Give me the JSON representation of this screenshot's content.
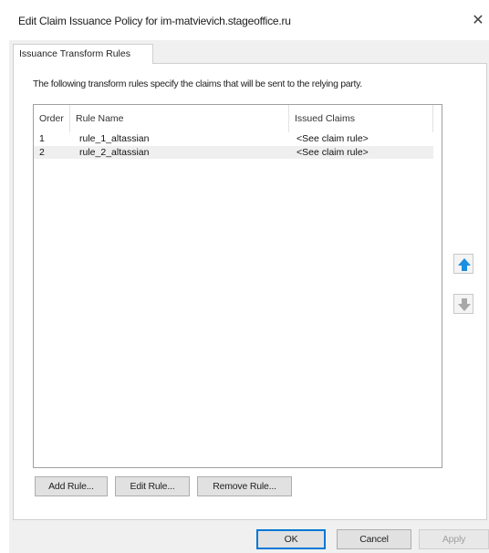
{
  "window": {
    "title": "Edit Claim Issuance Policy for im-matvievich.stageoffice.ru",
    "close_glyph": "✕"
  },
  "tabs": [
    {
      "label": "Issuance Transform Rules",
      "selected": true
    }
  ],
  "description": "The following transform rules specify the claims that will be sent to the relying party.",
  "rules_list": {
    "columns": [
      "Order",
      "Rule Name",
      "Issued Claims"
    ],
    "rows": [
      {
        "order": "1",
        "name": "rule_1_altassian",
        "claims": "<See claim rule>"
      },
      {
        "order": "2",
        "name": "rule_2_altassian",
        "claims": "<See claim rule>"
      }
    ],
    "selected_row": 1
  },
  "reorder": {
    "up_icon": "arrow-up-icon",
    "down_icon": "arrow-down-icon",
    "up_color": "#1e8fe0",
    "down_color": "#a8a8a8"
  },
  "rule_buttons": {
    "add": "Add Rule...",
    "edit": "Edit Rule...",
    "remove": "Remove Rule..."
  },
  "dialog_buttons": {
    "ok": "OK",
    "cancel": "Cancel",
    "apply": "Apply"
  }
}
